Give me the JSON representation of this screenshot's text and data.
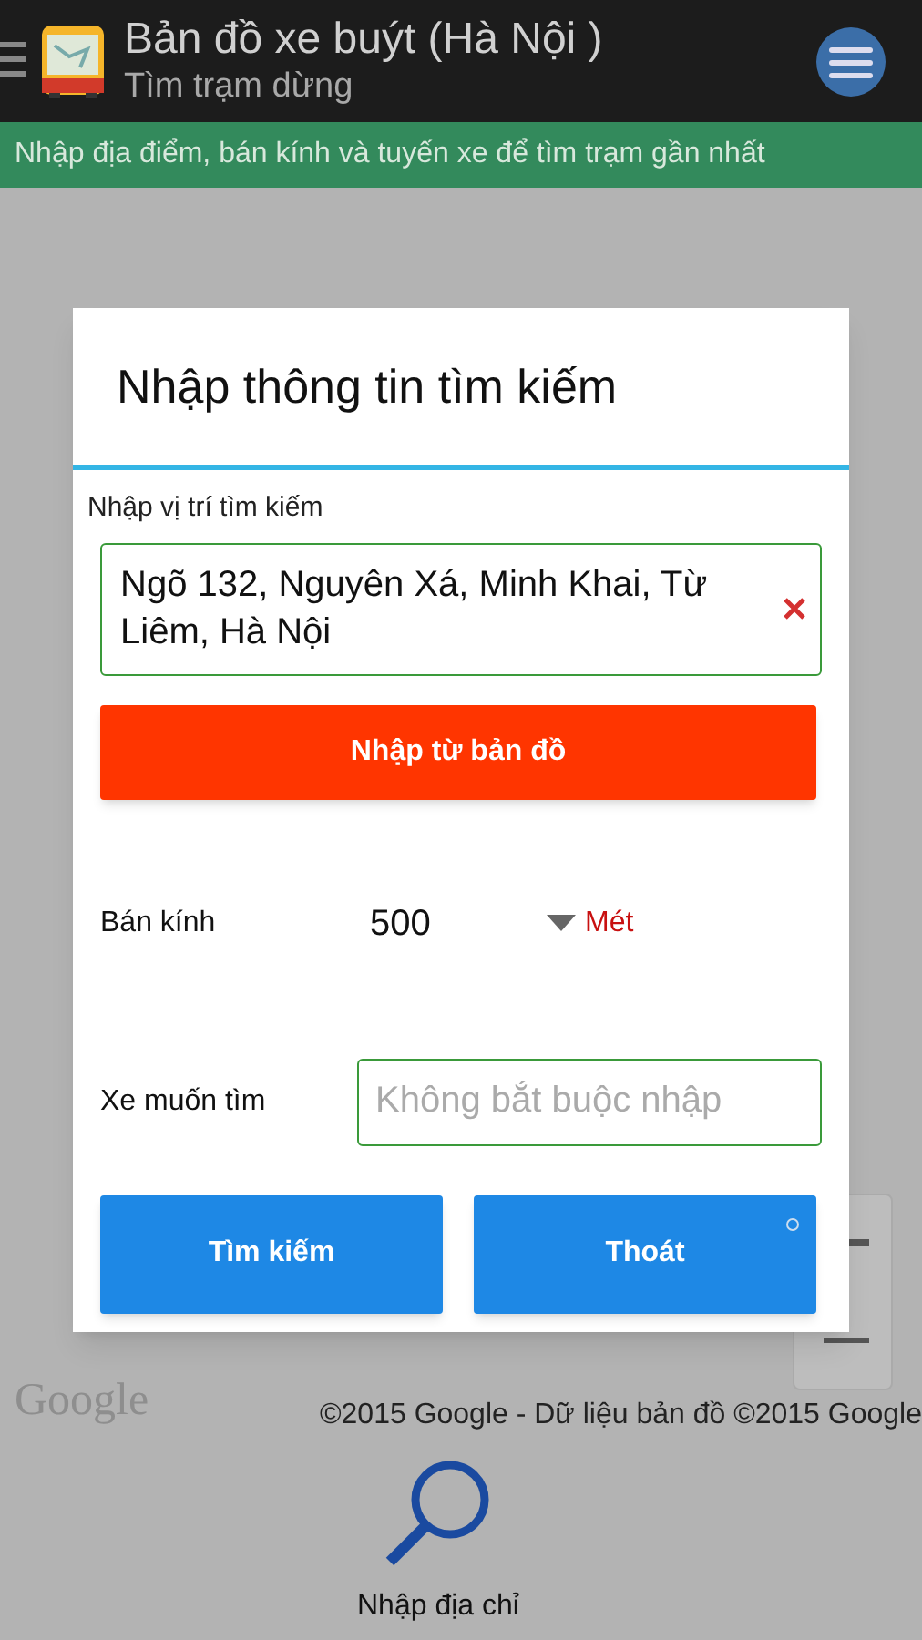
{
  "app_bar": {
    "title": "Bản đồ xe buýt (Hà Nội )",
    "subtitle": "Tìm trạm dừng"
  },
  "banner": "Nhập địa điểm, bán kính và tuyến xe để tìm trạm gần nhất",
  "dialog": {
    "title": "Nhập thông tin tìm kiếm",
    "location_label": "Nhập vị trí tìm kiếm",
    "location_field": {
      "value": "Ngõ 132, Nguyên Xá, Minh Khai, Từ Liêm, Hà Nội"
    },
    "map_button": "Nhập từ bản đồ",
    "radius": {
      "label": "Bán kính",
      "value": "500",
      "unit": "Mét"
    },
    "bus": {
      "label": "Xe muốn tìm",
      "placeholder": "Không bắt buộc nhập"
    },
    "buttons": [
      "Tìm kiếm",
      "Thoát"
    ]
  },
  "map": {
    "logo": "Google",
    "attribution": "©2015 Google - Dữ liệu bản đồ ©2015 Google"
  },
  "bottom_action": {
    "label": "Nhập địa chỉ"
  }
}
